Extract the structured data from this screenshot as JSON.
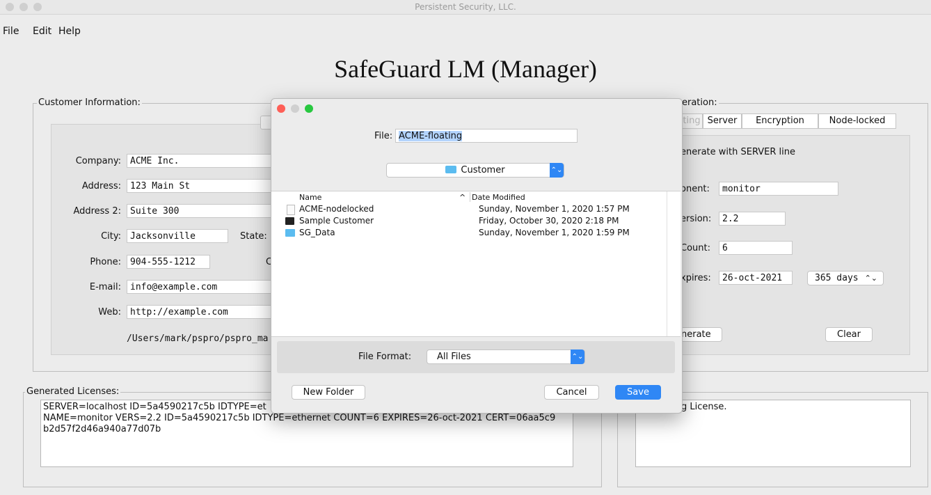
{
  "window": {
    "title": "Persistent Security, LLC."
  },
  "menu": [
    "File",
    "Edit",
    "Help"
  ],
  "app_title": "SafeGuard LM (Manager)",
  "customer": {
    "group_label": "Customer Information:",
    "labels": {
      "company": "Company:",
      "address": "Address:",
      "address2": "Address 2:",
      "city": "City:",
      "state": "State:",
      "phone": "Phone:",
      "email": "E-mail:",
      "web": "Web:",
      "country_partial": "C"
    },
    "values": {
      "company": "ACME Inc.",
      "address": "123 Main St",
      "address2": "Suite 300",
      "city": "Jacksonville",
      "phone": "904-555-1212",
      "email": "info@example.com",
      "web": "http://example.com"
    },
    "path": "/Users/mark/pspro/pspro_ma"
  },
  "generation": {
    "group_label": "eration:",
    "tabs": [
      "ting",
      "Server",
      "Encryption",
      "Node-locked"
    ],
    "checkbox_label": "enerate with SERVER line",
    "labels": {
      "component": "onent:",
      "version": "ersion:",
      "count": "Count:",
      "expires": "xpires:"
    },
    "values": {
      "component": "monitor",
      "version": "2.2",
      "count": "6",
      "expires": "26-oct-2021",
      "days": "365 days"
    },
    "generate_label": "nerate",
    "clear_label": "Clear"
  },
  "licenses": {
    "group_label": "Generated Licenses:",
    "lines": [
      "SERVER=localhost ID=5a4590217c5b IDTYPE=et",
      "NAME=monitor VERS=2.2 ID=5a4590217c5b IDTYPE=ethernet COUNT=6 EXPIRES=26-oct-2021 CERT=06aa5c9",
      "b2d57f2d46a940a77d07b"
    ]
  },
  "right_log": {
    "text": "g License."
  },
  "dialog": {
    "file_label": "File:",
    "file_value": "ACME-floating",
    "location": "Customer",
    "col_name": "Name",
    "col_date": "Date Modified",
    "files": [
      {
        "name": "ACME-nodelocked",
        "date": "Sunday, November 1, 2020 1:57 PM",
        "icon": "document-icon"
      },
      {
        "name": "Sample Customer",
        "date": "Friday, October 30, 2020 2:18 PM",
        "icon": "terminal-icon"
      },
      {
        "name": "SG_Data",
        "date": "Sunday, November 1, 2020 1:59 PM",
        "icon": "folder-icon"
      }
    ],
    "format_label": "File Format:",
    "format_value": "All Files",
    "new_folder": "New Folder",
    "cancel": "Cancel",
    "save": "Save"
  },
  "colors": {
    "accent": "#2f87f5",
    "selection": "#b3d4fd",
    "close": "#fe5f57",
    "minimize": "#febc2e",
    "zoom": "#28c840",
    "folder": "#5bbcf0"
  }
}
